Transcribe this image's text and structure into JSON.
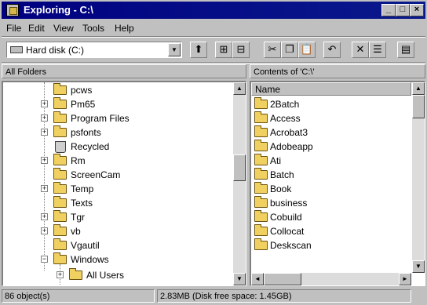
{
  "window": {
    "title": "Exploring - C:\\"
  },
  "titlebar_buttons": {
    "minimize": "_",
    "maximize": "□",
    "close": "×"
  },
  "menu": [
    {
      "label": "File"
    },
    {
      "label": "Edit"
    },
    {
      "label": "View"
    },
    {
      "label": "Tools"
    },
    {
      "label": "Help"
    }
  ],
  "address": {
    "value": "Hard disk (C:)",
    "dropdown_glyph": "▼"
  },
  "toolbar": {
    "buttons": [
      {
        "icon": "up-folder-icon",
        "glyph": "⬆"
      },
      {
        "icon": "map-drive-icon",
        "glyph": "⊞"
      },
      {
        "icon": "disconnect-drive-icon",
        "glyph": "⊟"
      },
      {
        "icon": "cut-icon",
        "glyph": "✂"
      },
      {
        "icon": "copy-icon",
        "glyph": "❐"
      },
      {
        "icon": "paste-icon",
        "glyph": "📋"
      },
      {
        "icon": "undo-icon",
        "glyph": "↶"
      },
      {
        "icon": "delete-icon",
        "glyph": "✕"
      },
      {
        "icon": "properties-icon",
        "glyph": "☰"
      },
      {
        "icon": "large-icons-icon",
        "glyph": "▤"
      }
    ]
  },
  "left_pane": {
    "header": "All Folders",
    "items": [
      {
        "label": "pcws",
        "expander": "",
        "type": "folder"
      },
      {
        "label": "Pm65",
        "expander": "+",
        "type": "folder"
      },
      {
        "label": "Program Files",
        "expander": "+",
        "type": "folder"
      },
      {
        "label": "psfonts",
        "expander": "+",
        "type": "folder"
      },
      {
        "label": "Recycled",
        "expander": "",
        "type": "recycle"
      },
      {
        "label": "Rm",
        "expander": "+",
        "type": "folder"
      },
      {
        "label": "ScreenCam",
        "expander": "",
        "type": "folder"
      },
      {
        "label": "Temp",
        "expander": "+",
        "type": "folder"
      },
      {
        "label": "Texts",
        "expander": "",
        "type": "folder"
      },
      {
        "label": "Tgr",
        "expander": "+",
        "type": "folder"
      },
      {
        "label": "vb",
        "expander": "+",
        "type": "folder"
      },
      {
        "label": "Vgautil",
        "expander": "",
        "type": "folder"
      },
      {
        "label": "Windows",
        "expander": "−",
        "type": "folder"
      },
      {
        "label": "All Users",
        "expander": "+",
        "type": "folder"
      }
    ]
  },
  "right_pane": {
    "header": "Contents of 'C:\\'",
    "column_header": "Name",
    "items": [
      {
        "label": "2Batch"
      },
      {
        "label": "Access"
      },
      {
        "label": "Acrobat3"
      },
      {
        "label": "Adobeapp"
      },
      {
        "label": "Ati"
      },
      {
        "label": "Batch"
      },
      {
        "label": "Book"
      },
      {
        "label": "business"
      },
      {
        "label": "Cobuild"
      },
      {
        "label": "Collocat"
      },
      {
        "label": "Deskscan"
      }
    ]
  },
  "scroll_glyphs": {
    "up": "▲",
    "down": "▼",
    "left": "◄",
    "right": "►"
  },
  "status": {
    "objects": "86 object(s)",
    "disk": "2.83MB (Disk free space: 1.45GB)"
  }
}
